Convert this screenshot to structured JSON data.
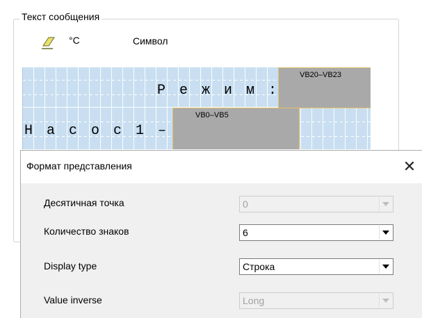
{
  "message_group": {
    "title": "Текст сообщения",
    "toolbar": {
      "eraser_icon": "eraser-icon",
      "degree_label": "°C",
      "symbol_label": "Символ"
    }
  },
  "lcd": {
    "row1_chars": [
      "Р",
      "е",
      "ж",
      "и",
      "м",
      ":"
    ],
    "row2_chars": [
      "Н",
      "а",
      "с",
      "о",
      "с",
      "1",
      "–"
    ],
    "field_vb20": "VB20–VB23",
    "field_vb0": "VB0–VB5"
  },
  "dialog": {
    "title": "Формат представления",
    "close_glyph": "✕",
    "rows": [
      {
        "label": "Десятичная точка",
        "value": "0",
        "enabled": false
      },
      {
        "label": "Количество знаков",
        "value": "6",
        "enabled": true
      },
      {
        "label": "Display type",
        "value": "Строка",
        "enabled": true
      },
      {
        "label": "Value inverse",
        "value": "Long",
        "enabled": false
      }
    ]
  }
}
